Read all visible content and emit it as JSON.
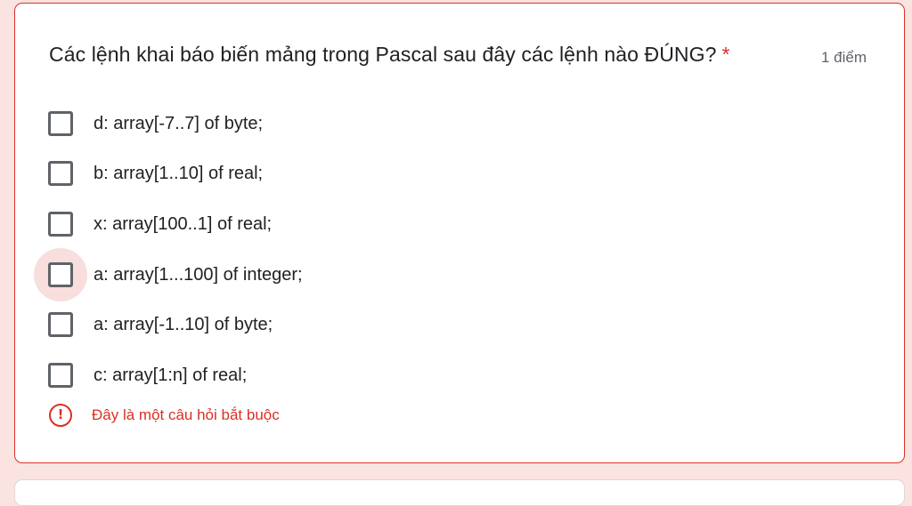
{
  "question": {
    "title": "Các lệnh khai báo biến mảng trong Pascal sau đây các lệnh nào ĐÚNG?",
    "required_marker": "*",
    "points": "1 điểm"
  },
  "options": [
    {
      "label": "d: array[-7..7] of byte;",
      "checked": false
    },
    {
      "label": "b: array[1..10] of real;",
      "checked": false
    },
    {
      "label": "x: array[100..1] of real;",
      "checked": false
    },
    {
      "label": "a: array[1...100] of integer;",
      "checked": false,
      "focused": true
    },
    {
      "label": "a: array[-1..10] of byte;",
      "checked": false
    },
    {
      "label": "c: array[1:n] of real;",
      "checked": false
    }
  ],
  "validation": {
    "icon": "exclamation-circle-icon",
    "message": "Đây là một câu hỏi bắt buộc"
  },
  "colors": {
    "background": "#fbe3e1",
    "error": "#d93025",
    "text": "#202124",
    "secondary_text": "#5f6368",
    "checkbox_border": "#5f6368",
    "focus_ripple": "#f8dedd"
  }
}
